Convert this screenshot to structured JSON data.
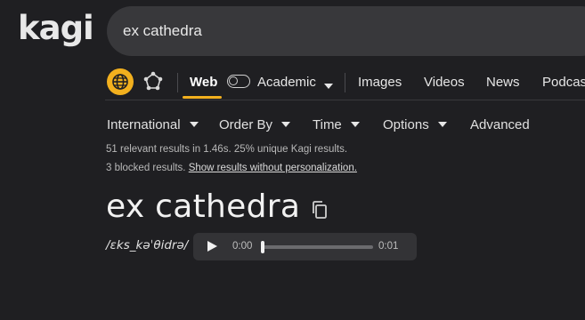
{
  "logo": "kagi",
  "search": {
    "value": "ex cathedra"
  },
  "nav": {
    "web": "Web",
    "academic": "Academic",
    "images": "Images",
    "videos": "Videos",
    "news": "News",
    "podcasts": "Podcas"
  },
  "filters": {
    "international": "International",
    "order_by": "Order By",
    "time": "Time",
    "options": "Options",
    "advanced": "Advanced"
  },
  "stats": {
    "line1": "51 relevant results in 1.46s. 25% unique Kagi results.",
    "line2_prefix": "3 blocked results.",
    "line2_link": "Show results without personalization."
  },
  "result": {
    "title": "ex cathedra",
    "ipa": "/ɛks_kəˈθidrə/"
  },
  "audio": {
    "current": "0:00",
    "duration": "0:01",
    "progress": 0
  },
  "colors": {
    "accent": "#f2b01e",
    "background": "#1f1f22"
  }
}
